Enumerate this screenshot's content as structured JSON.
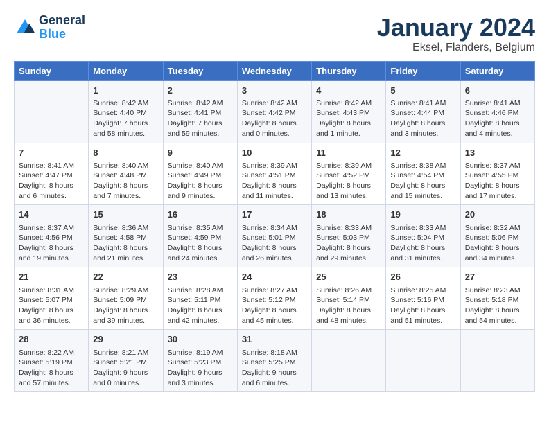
{
  "header": {
    "logo_line1": "General",
    "logo_line2": "Blue",
    "main_title": "January 2024",
    "subtitle": "Eksel, Flanders, Belgium"
  },
  "days_of_week": [
    "Sunday",
    "Monday",
    "Tuesday",
    "Wednesday",
    "Thursday",
    "Friday",
    "Saturday"
  ],
  "weeks": [
    [
      {
        "day": "",
        "info": ""
      },
      {
        "day": "1",
        "info": "Sunrise: 8:42 AM\nSunset: 4:40 PM\nDaylight: 7 hours\nand 58 minutes."
      },
      {
        "day": "2",
        "info": "Sunrise: 8:42 AM\nSunset: 4:41 PM\nDaylight: 7 hours\nand 59 minutes."
      },
      {
        "day": "3",
        "info": "Sunrise: 8:42 AM\nSunset: 4:42 PM\nDaylight: 8 hours\nand 0 minutes."
      },
      {
        "day": "4",
        "info": "Sunrise: 8:42 AM\nSunset: 4:43 PM\nDaylight: 8 hours\nand 1 minute."
      },
      {
        "day": "5",
        "info": "Sunrise: 8:41 AM\nSunset: 4:44 PM\nDaylight: 8 hours\nand 3 minutes."
      },
      {
        "day": "6",
        "info": "Sunrise: 8:41 AM\nSunset: 4:46 PM\nDaylight: 8 hours\nand 4 minutes."
      }
    ],
    [
      {
        "day": "7",
        "info": "Sunrise: 8:41 AM\nSunset: 4:47 PM\nDaylight: 8 hours\nand 6 minutes."
      },
      {
        "day": "8",
        "info": "Sunrise: 8:40 AM\nSunset: 4:48 PM\nDaylight: 8 hours\nand 7 minutes."
      },
      {
        "day": "9",
        "info": "Sunrise: 8:40 AM\nSunset: 4:49 PM\nDaylight: 8 hours\nand 9 minutes."
      },
      {
        "day": "10",
        "info": "Sunrise: 8:39 AM\nSunset: 4:51 PM\nDaylight: 8 hours\nand 11 minutes."
      },
      {
        "day": "11",
        "info": "Sunrise: 8:39 AM\nSunset: 4:52 PM\nDaylight: 8 hours\nand 13 minutes."
      },
      {
        "day": "12",
        "info": "Sunrise: 8:38 AM\nSunset: 4:54 PM\nDaylight: 8 hours\nand 15 minutes."
      },
      {
        "day": "13",
        "info": "Sunrise: 8:37 AM\nSunset: 4:55 PM\nDaylight: 8 hours\nand 17 minutes."
      }
    ],
    [
      {
        "day": "14",
        "info": "Sunrise: 8:37 AM\nSunset: 4:56 PM\nDaylight: 8 hours\nand 19 minutes."
      },
      {
        "day": "15",
        "info": "Sunrise: 8:36 AM\nSunset: 4:58 PM\nDaylight: 8 hours\nand 21 minutes."
      },
      {
        "day": "16",
        "info": "Sunrise: 8:35 AM\nSunset: 4:59 PM\nDaylight: 8 hours\nand 24 minutes."
      },
      {
        "day": "17",
        "info": "Sunrise: 8:34 AM\nSunset: 5:01 PM\nDaylight: 8 hours\nand 26 minutes."
      },
      {
        "day": "18",
        "info": "Sunrise: 8:33 AM\nSunset: 5:03 PM\nDaylight: 8 hours\nand 29 minutes."
      },
      {
        "day": "19",
        "info": "Sunrise: 8:33 AM\nSunset: 5:04 PM\nDaylight: 8 hours\nand 31 minutes."
      },
      {
        "day": "20",
        "info": "Sunrise: 8:32 AM\nSunset: 5:06 PM\nDaylight: 8 hours\nand 34 minutes."
      }
    ],
    [
      {
        "day": "21",
        "info": "Sunrise: 8:31 AM\nSunset: 5:07 PM\nDaylight: 8 hours\nand 36 minutes."
      },
      {
        "day": "22",
        "info": "Sunrise: 8:29 AM\nSunset: 5:09 PM\nDaylight: 8 hours\nand 39 minutes."
      },
      {
        "day": "23",
        "info": "Sunrise: 8:28 AM\nSunset: 5:11 PM\nDaylight: 8 hours\nand 42 minutes."
      },
      {
        "day": "24",
        "info": "Sunrise: 8:27 AM\nSunset: 5:12 PM\nDaylight: 8 hours\nand 45 minutes."
      },
      {
        "day": "25",
        "info": "Sunrise: 8:26 AM\nSunset: 5:14 PM\nDaylight: 8 hours\nand 48 minutes."
      },
      {
        "day": "26",
        "info": "Sunrise: 8:25 AM\nSunset: 5:16 PM\nDaylight: 8 hours\nand 51 minutes."
      },
      {
        "day": "27",
        "info": "Sunrise: 8:23 AM\nSunset: 5:18 PM\nDaylight: 8 hours\nand 54 minutes."
      }
    ],
    [
      {
        "day": "28",
        "info": "Sunrise: 8:22 AM\nSunset: 5:19 PM\nDaylight: 8 hours\nand 57 minutes."
      },
      {
        "day": "29",
        "info": "Sunrise: 8:21 AM\nSunset: 5:21 PM\nDaylight: 9 hours\nand 0 minutes."
      },
      {
        "day": "30",
        "info": "Sunrise: 8:19 AM\nSunset: 5:23 PM\nDaylight: 9 hours\nand 3 minutes."
      },
      {
        "day": "31",
        "info": "Sunrise: 8:18 AM\nSunset: 5:25 PM\nDaylight: 9 hours\nand 6 minutes."
      },
      {
        "day": "",
        "info": ""
      },
      {
        "day": "",
        "info": ""
      },
      {
        "day": "",
        "info": ""
      }
    ]
  ]
}
